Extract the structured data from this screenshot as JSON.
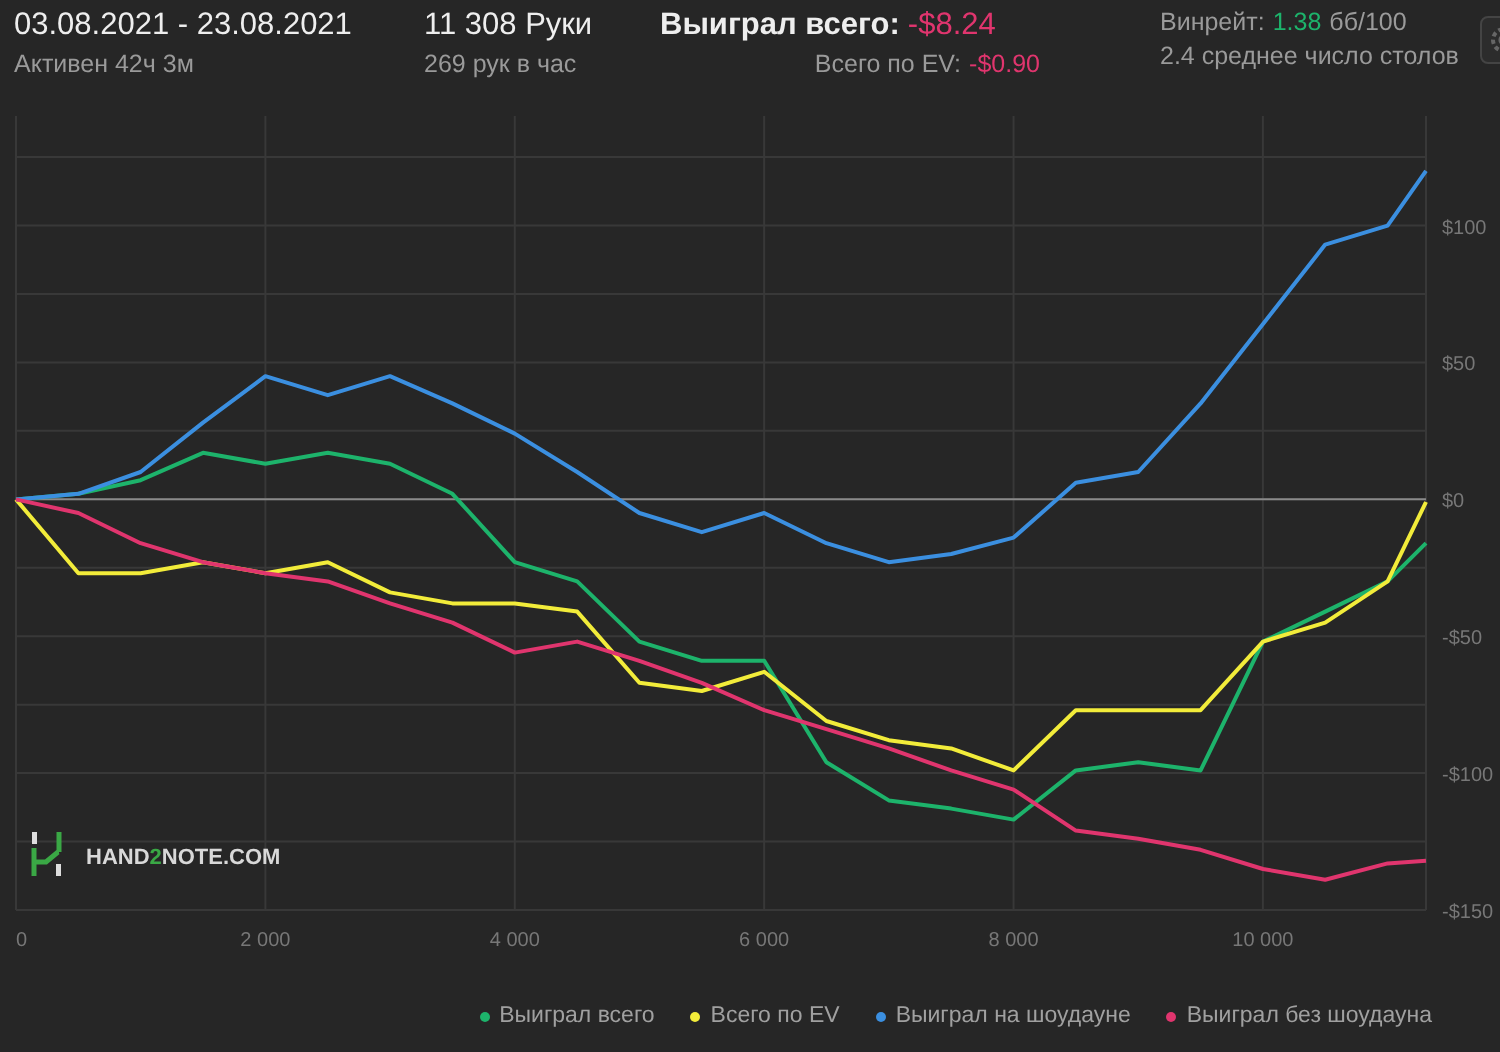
{
  "header": {
    "period": "03.08.2021 - 23.08.2021",
    "active": "Активен 42ч 3м",
    "hands": "11 308 Руки",
    "hands_per_hour": "269 рук в час",
    "won_label": "Выиграл всего:",
    "won_value": "-$8.24",
    "ev_label": "Всего по EV:",
    "ev_value": "-$0.90",
    "winrate_label": "Винрейт:",
    "winrate_value": "1.38",
    "winrate_unit": "бб/100",
    "tables": "2.4 среднее число столов"
  },
  "logo": {
    "parts": [
      "HAND",
      "2",
      "NOTE.COM"
    ]
  },
  "chart_data": {
    "type": "line",
    "grid": true,
    "x": [
      0,
      500,
      1000,
      1500,
      2000,
      2500,
      3000,
      3500,
      4000,
      4500,
      5000,
      5500,
      6000,
      6500,
      7000,
      7500,
      8000,
      8500,
      9000,
      9500,
      10000,
      10500,
      11000,
      11308
    ],
    "xlim": [
      0,
      11308
    ],
    "ylim": [
      -150,
      140
    ],
    "xticks": [
      {
        "value": 0,
        "label": "0"
      },
      {
        "value": 2000,
        "label": "2 000"
      },
      {
        "value": 4000,
        "label": "4 000"
      },
      {
        "value": 6000,
        "label": "6 000"
      },
      {
        "value": 8000,
        "label": "8 000"
      },
      {
        "value": 10000,
        "label": "10 000"
      }
    ],
    "yticks": [
      {
        "value": 100,
        "label": "$100"
      },
      {
        "value": 50,
        "label": "$50"
      },
      {
        "value": 0,
        "label": "$0"
      },
      {
        "value": -50,
        "label": "-$50"
      },
      {
        "value": -100,
        "label": "-$100"
      },
      {
        "value": -150,
        "label": "-$150"
      }
    ],
    "series": [
      {
        "name": "Выиграл всего",
        "color": "#1db36b",
        "values": [
          0,
          2,
          7,
          17,
          13,
          17,
          13,
          2,
          -23,
          -30,
          -52,
          -59,
          -59,
          -96,
          -110,
          -113,
          -117,
          -99,
          -96,
          -99,
          -52,
          -41,
          -30,
          -16
        ]
      },
      {
        "name": "Всего по EV",
        "color": "#f2ec3a",
        "values": [
          0,
          -27,
          -27,
          -23,
          -27,
          -23,
          -34,
          -38,
          -38,
          -41,
          -67,
          -70,
          -63,
          -81,
          -88,
          -91,
          -99,
          -77,
          -77,
          -77,
          -52,
          -45,
          -30,
          -1
        ]
      },
      {
        "name": "Выиграл на шоудауне",
        "color": "#3b8fe0",
        "values": [
          0,
          2,
          10,
          28,
          45,
          38,
          45,
          35,
          24,
          10,
          -5,
          -12,
          -5,
          -16,
          -23,
          -20,
          -14,
          6,
          10,
          35,
          64,
          93,
          100,
          120
        ]
      },
      {
        "name": "Выиграл без шоудауна",
        "color": "#e0356e",
        "values": [
          0,
          -5,
          -16,
          -23,
          -27,
          -30,
          -38,
          -45,
          -56,
          -52,
          -59,
          -67,
          -77,
          -84,
          -91,
          -99,
          -106,
          -121,
          -124,
          -128,
          -135,
          -139,
          -133,
          -132
        ]
      }
    ]
  }
}
